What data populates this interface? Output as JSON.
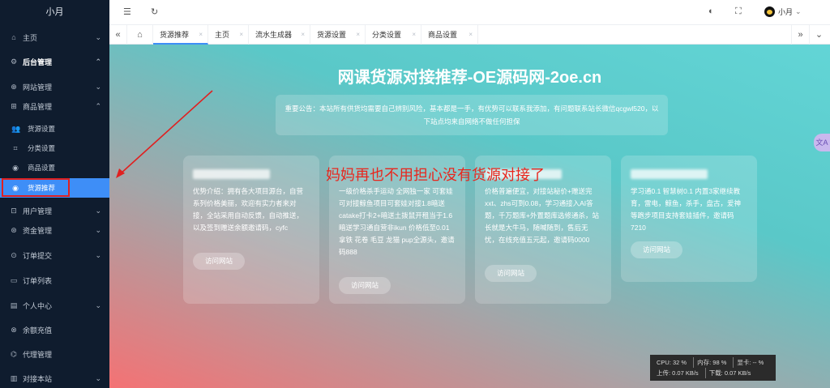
{
  "sidebar": {
    "title": "小月",
    "items": [
      {
        "label": "主页",
        "icon": "⌂",
        "chevron": "⌄"
      },
      {
        "label": "后台管理",
        "icon": "⚙",
        "chevron": "⌃"
      },
      {
        "label": "网站管理",
        "icon": "⊕",
        "chevron": "⌄"
      },
      {
        "label": "商品管理",
        "icon": "⊞",
        "chevron": "⌃"
      },
      {
        "label": "货源设置",
        "icon": "👥"
      },
      {
        "label": "分类设置",
        "icon": "⌗"
      },
      {
        "label": "商品设置",
        "icon": "◉"
      },
      {
        "label": "货源推荐",
        "icon": "◉"
      },
      {
        "label": "用户管理",
        "icon": "⊡",
        "chevron": "⌄"
      },
      {
        "label": "资金管理",
        "icon": "⊛",
        "chevron": "⌄"
      },
      {
        "label": "订单提交",
        "icon": "⊙",
        "chevron": "⌄"
      },
      {
        "label": "订单列表",
        "icon": "▭"
      },
      {
        "label": "个人中心",
        "icon": "▤",
        "chevron": "⌄"
      },
      {
        "label": "余额充值",
        "icon": "⊗"
      },
      {
        "label": "代理管理",
        "icon": "⌬"
      },
      {
        "label": "对接本站",
        "icon": "▥",
        "chevron": "⌄"
      }
    ]
  },
  "header": {
    "menu_icon": "☰",
    "refresh_icon": "↻",
    "theme_icon": "◐",
    "fullscreen_icon": "⛶",
    "user_name": "小月",
    "user_chevron": "⌄"
  },
  "tabs": {
    "prev_icon": "«",
    "home_icon": "⌂",
    "next_icon": "»",
    "more_icon": "⌄",
    "close_glyph": "×",
    "items": [
      {
        "label": "货源推荐"
      },
      {
        "label": "主页"
      },
      {
        "label": "流水生成器"
      },
      {
        "label": "货源设置"
      },
      {
        "label": "分类设置"
      },
      {
        "label": "商品设置"
      }
    ]
  },
  "main": {
    "title": "网课货源对接推荐-OE源码网-2oe.cn",
    "notice": "重要公告：本站所有供货均需要自己辨别风险，基本都是一手，有优势可以联系我添加，有问题联系站长微信qcgwl520，以下站点均来自网络不做任何担保",
    "overlay_text": "妈妈再也不用担心没有货源对接了",
    "cards": [
      {
        "desc": "优势介绍：拥有各大项目源台，自营系列价格美丽，欢迎有实力者来对接，全站采用自动反馈，自动推送，以及签到赠送余额邀请码，cyfc",
        "button": "访问网站"
      },
      {
        "desc": "一级价格杀手运动 全网独一家 可套娃可对接鲸鱼项目可套娃对接1.8暗送 catake打卡2+暗送土拨鼠开租当于1.6暗送学习通自营非ikun 价格低至0.01 拿铁 花卷 毛豆 龙猫 pup全源头，邀请码888",
        "button": "访问网站"
      },
      {
        "desc": "价格普遍便宜，对接站秘价+赠送完xxt、zhs可到0.08，学习通接入AI答题，千万题库+外置题库选修通杀，站长就是大牛马，随喊随到，售后无忧，在线充值五元起，邀请码0000",
        "button": "访问网站"
      },
      {
        "desc": "学习通0.1 智慧树0.1 内置3家继续教育，雷电，鲸鱼，杀手，盘古，爱神等跑步项目支持套娃插件，邀请码7210",
        "button": "访问网站"
      }
    ],
    "stats": {
      "cpu": "CPU: 32 %",
      "mem": "内存: 98 %",
      "gpu": "显卡: -- %",
      "up": "上传: 0.07 KB/s",
      "down": "下载: 0.07 KB/s"
    },
    "fab_label": "文A"
  },
  "colors": {
    "sidebar_bg": "#0f1c2e",
    "active_blue": "#3e8ef7",
    "annotation_red": "#e02020"
  }
}
